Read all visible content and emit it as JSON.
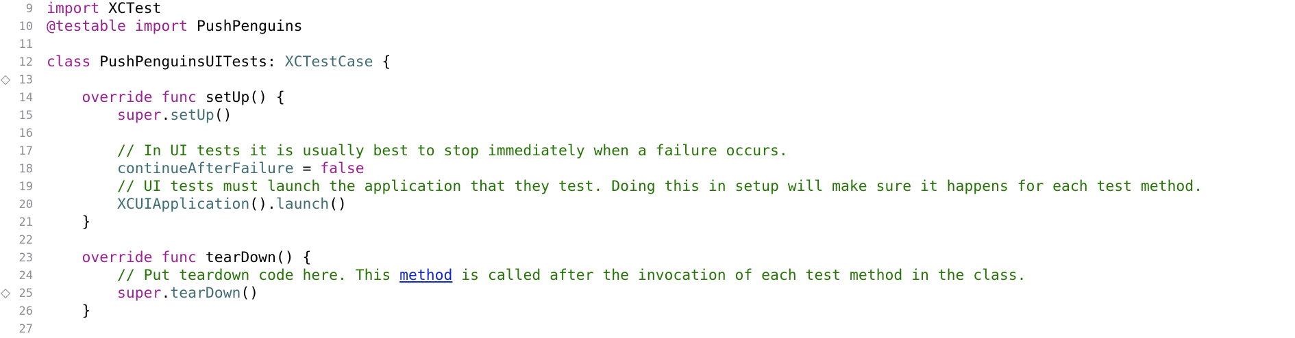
{
  "colors": {
    "background": "#ffffff",
    "line_number": "#8e8e93",
    "keyword": "#9b2393",
    "type_or_api": "#3f6e74",
    "comment": "#267507",
    "link": "#0f26d4",
    "plain": "#000000"
  },
  "gutter_markers": [
    {
      "line": "13",
      "icon": "diamond-breakpoint-marker-icon"
    },
    {
      "line": "25",
      "icon": "diamond-breakpoint-marker-icon"
    }
  ],
  "lines": [
    {
      "num": "9",
      "tokens": [
        {
          "t": "import",
          "c": "kw"
        },
        {
          "t": " XCTest",
          "c": "plain"
        }
      ]
    },
    {
      "num": "10",
      "tokens": [
        {
          "t": "@testable import",
          "c": "kw"
        },
        {
          "t": " PushPenguins",
          "c": "plain"
        }
      ]
    },
    {
      "num": "11",
      "tokens": []
    },
    {
      "num": "12",
      "tokens": [
        {
          "t": "class",
          "c": "kw"
        },
        {
          "t": " PushPenguinsUITests: ",
          "c": "plain"
        },
        {
          "t": "XCTestCase",
          "c": "type"
        },
        {
          "t": " {",
          "c": "plain"
        }
      ]
    },
    {
      "num": "13",
      "tokens": []
    },
    {
      "num": "14",
      "tokens": [
        {
          "t": "    ",
          "c": "plain"
        },
        {
          "t": "override func",
          "c": "kw"
        },
        {
          "t": " setUp() {",
          "c": "plain"
        }
      ]
    },
    {
      "num": "15",
      "tokens": [
        {
          "t": "        ",
          "c": "plain"
        },
        {
          "t": "super",
          "c": "kw"
        },
        {
          "t": ".",
          "c": "plain"
        },
        {
          "t": "setUp",
          "c": "fn"
        },
        {
          "t": "()",
          "c": "plain"
        }
      ]
    },
    {
      "num": "16",
      "tokens": []
    },
    {
      "num": "17",
      "tokens": [
        {
          "t": "        // In UI tests it is usually best to stop immediately when a failure occurs.",
          "c": "cm"
        }
      ]
    },
    {
      "num": "18",
      "tokens": [
        {
          "t": "        ",
          "c": "plain"
        },
        {
          "t": "continueAfterFailure",
          "c": "fn"
        },
        {
          "t": " = ",
          "c": "plain"
        },
        {
          "t": "false",
          "c": "kw"
        }
      ]
    },
    {
      "num": "19",
      "tokens": [
        {
          "t": "        // UI tests must launch the application that they test. Doing this in setup will make sure it happens for each test method.",
          "c": "cm"
        }
      ]
    },
    {
      "num": "20",
      "tokens": [
        {
          "t": "        ",
          "c": "plain"
        },
        {
          "t": "XCUIApplication",
          "c": "type"
        },
        {
          "t": "().",
          "c": "plain"
        },
        {
          "t": "launch",
          "c": "fn"
        },
        {
          "t": "()",
          "c": "plain"
        }
      ]
    },
    {
      "num": "21",
      "tokens": [
        {
          "t": "    }",
          "c": "plain"
        }
      ]
    },
    {
      "num": "22",
      "tokens": []
    },
    {
      "num": "23",
      "tokens": [
        {
          "t": "    ",
          "c": "plain"
        },
        {
          "t": "override func",
          "c": "kw"
        },
        {
          "t": " tearDown() {",
          "c": "plain"
        }
      ]
    },
    {
      "num": "24",
      "tokens": [
        {
          "t": "        // Put teardown code here. This ",
          "c": "cm"
        },
        {
          "t": "method",
          "c": "lnk"
        },
        {
          "t": " is called after the invocation of each test method in the class.",
          "c": "cm"
        }
      ]
    },
    {
      "num": "25",
      "tokens": [
        {
          "t": "        ",
          "c": "plain"
        },
        {
          "t": "super",
          "c": "kw"
        },
        {
          "t": ".",
          "c": "plain"
        },
        {
          "t": "tearDown",
          "c": "fn"
        },
        {
          "t": "()",
          "c": "plain"
        }
      ]
    },
    {
      "num": "26",
      "tokens": [
        {
          "t": "    }",
          "c": "plain"
        }
      ]
    },
    {
      "num": "27",
      "tokens": []
    }
  ]
}
